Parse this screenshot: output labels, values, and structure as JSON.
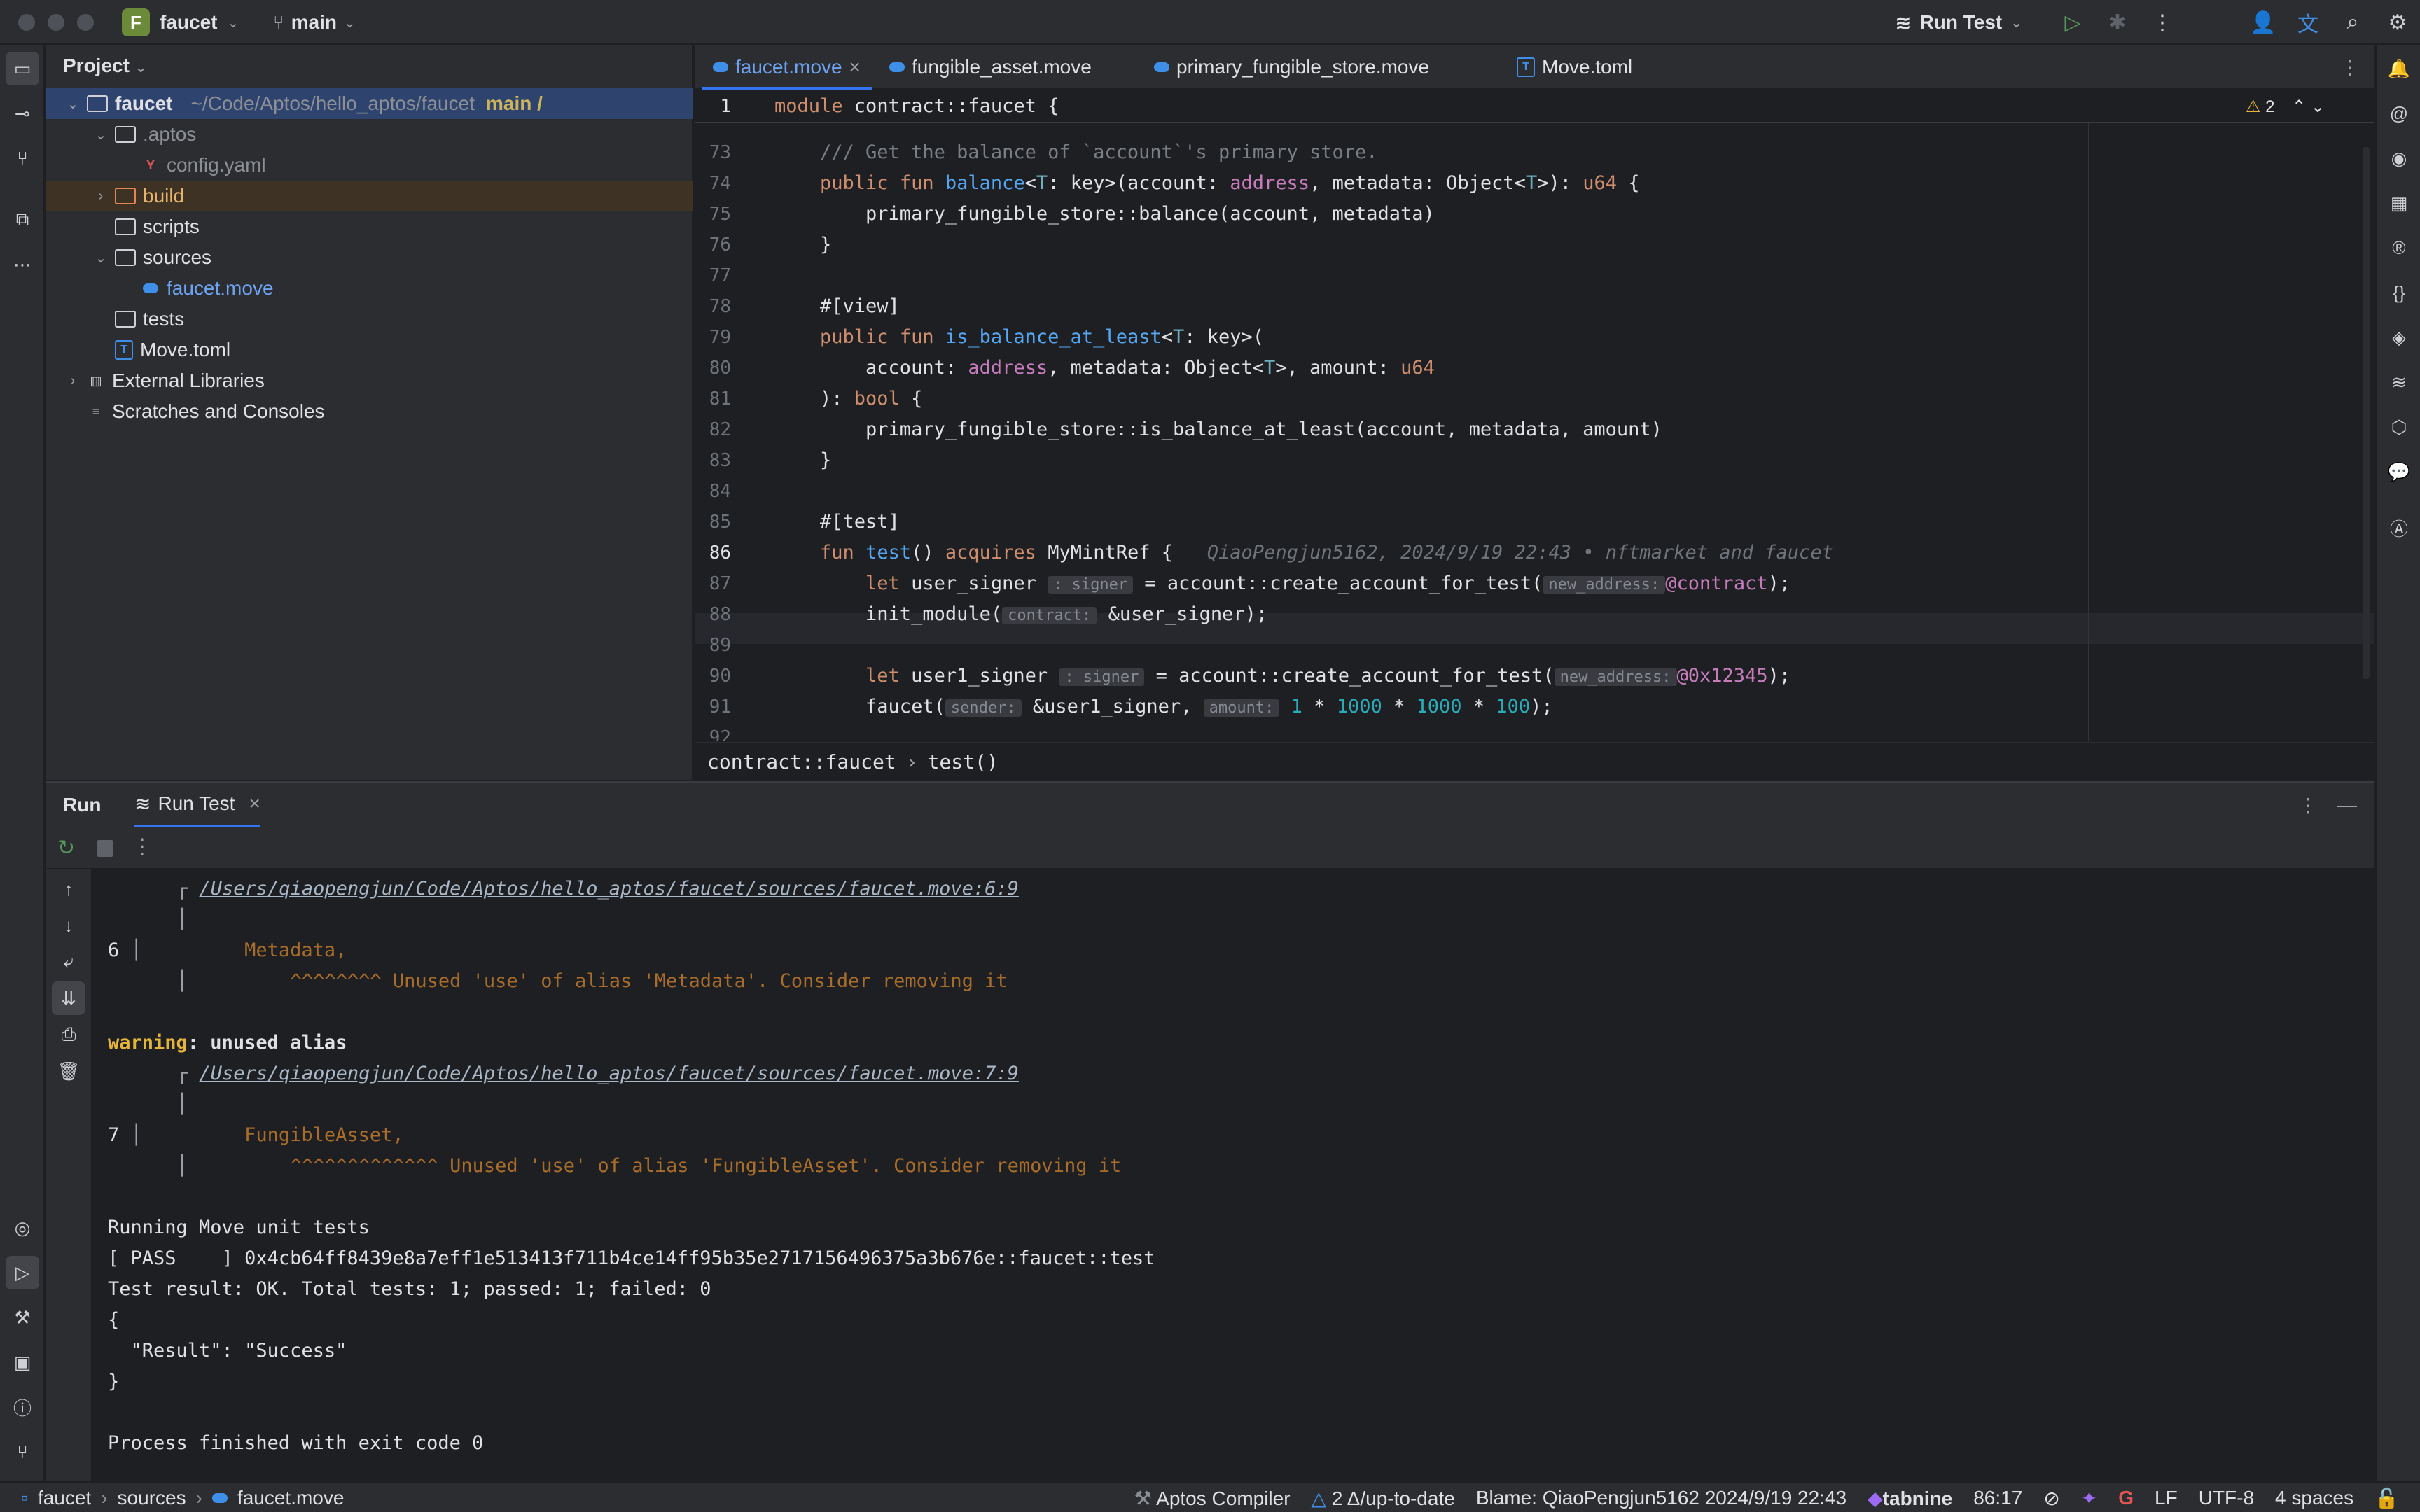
{
  "titlebar": {
    "project_badge": "F",
    "project_name": "faucet",
    "branch": "main",
    "run_config": "Run Test"
  },
  "project_panel": {
    "title": "Project",
    "tree": [
      {
        "label": "faucet",
        "path": "~/Code/Aptos/hello_aptos/faucet",
        "branch": "main /"
      },
      {
        "label": ".aptos"
      },
      {
        "label": "config.yaml"
      },
      {
        "label": "build"
      },
      {
        "label": "scripts"
      },
      {
        "label": "sources"
      },
      {
        "label": "faucet.move"
      },
      {
        "label": "tests"
      },
      {
        "label": "Move.toml"
      },
      {
        "label": "External Libraries"
      },
      {
        "label": "Scratches and Consoles"
      }
    ]
  },
  "tabs": [
    {
      "label": "faucet.move"
    },
    {
      "label": "fungible_asset.move"
    },
    {
      "label": "primary_fungible_store.move"
    },
    {
      "label": "Move.toml"
    }
  ],
  "editor": {
    "sticky_line_no": "1",
    "sticky_code": "module contract::faucet {",
    "warnings": "2",
    "line_numbers": [
      "73",
      "74",
      "75",
      "76",
      "77",
      "78",
      "79",
      "80",
      "81",
      "82",
      "83",
      "84",
      "85",
      "86",
      "87",
      "88",
      "89",
      "90",
      "91",
      "92"
    ],
    "blame": "QiaoPengjun5162, 2024/9/19 22:43 • nftmarket and faucet",
    "hints": {
      "signer": ": signer",
      "new_address": "new_address:",
      "contract": "contract:",
      "sender": "sender:",
      "amount": "amount:"
    }
  },
  "breadcrumb": {
    "module": "contract::faucet",
    "fn": "test()"
  },
  "run_panel": {
    "tab_run": "Run",
    "tab_run_test": "Run Test",
    "console": [
      "/Users/qiaopengjun/Code/Aptos/hello_aptos/faucet/sources/faucet.move:6:9",
      "Metadata,",
      "^^^^^^^^ Unused 'use' of alias 'Metadata'. Consider removing it",
      "warning",
      ": unused alias",
      "/Users/qiaopengjun/Code/Aptos/hello_aptos/faucet/sources/faucet.move:7:9",
      "FungibleAsset,",
      "^^^^^^^^^^^^^ Unused 'use' of alias 'FungibleAsset'. Consider removing it",
      "Running Move unit tests",
      "[ PASS    ] 0x4cb64ff8439e8a7eff1e513413f711b4ce14ff95b35e2717156496375a3b676e::faucet::test",
      "Test result: OK. Total tests: 1; passed: 1; failed: 0",
      "{",
      "  \"Result\": \"Success\"",
      "}",
      "Process finished with exit code 0"
    ],
    "line6": "6",
    "line7": "7"
  },
  "statusbar": {
    "crumb": [
      "faucet",
      "sources",
      "faucet.move"
    ],
    "compiler": "Aptos Compiler",
    "git": "2 Δ/up-to-date",
    "blame": "Blame: QiaoPengjun5162 2024/9/19 22:43",
    "tabnine": "tabnine",
    "position": "86:17",
    "line_sep": "LF",
    "encoding": "UTF-8",
    "indent": "4 spaces"
  }
}
